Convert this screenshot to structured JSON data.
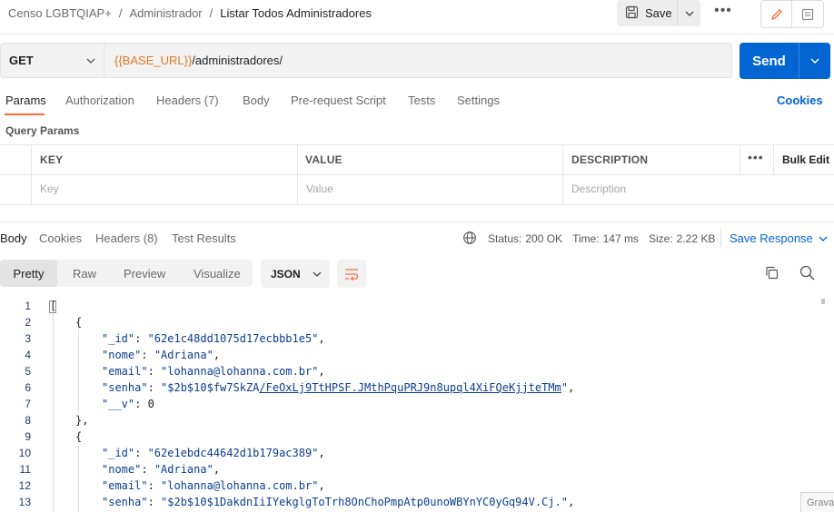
{
  "breadcrumb": {
    "collection": "Censo LGBTQIAP+",
    "folder": "Administrador",
    "separator": "/",
    "request": "Listar Todos Administradores"
  },
  "toolbar": {
    "save_label": "Save",
    "more_label": "•••"
  },
  "request": {
    "method": "GET",
    "url_variable": "{{BASE_URL}}",
    "url_path": "/administradores/",
    "send_label": "Send"
  },
  "request_tabs": [
    "Params",
    "Authorization",
    "Headers (7)",
    "Body",
    "Pre-request Script",
    "Tests",
    "Settings"
  ],
  "cookies_label": "Cookies",
  "query_params": {
    "title": "Query Params",
    "columns": [
      "KEY",
      "VALUE",
      "DESCRIPTION"
    ],
    "more_label": "•••",
    "bulk_edit_label": "Bulk Edit",
    "placeholders": [
      "Key",
      "Value",
      "Description"
    ]
  },
  "response_tabs": [
    "Body",
    "Cookies",
    "Headers (8)",
    "Test Results"
  ],
  "response_status": {
    "status_label": "Status:",
    "status_value": "200 OK",
    "time_label": "Time:",
    "time_value": "147 ms",
    "size_label": "Size:",
    "size_value": "2.22 KB",
    "save_response_label": "Save Response"
  },
  "view_modes": [
    "Pretty",
    "Raw",
    "Preview",
    "Visualize"
  ],
  "format": "JSON",
  "code_lines": [
    {
      "n": "1"
    },
    {
      "n": "2"
    },
    {
      "n": "3",
      "key": "\"_id\"",
      "value": "\"62e1c48dd1075d17ecbbb1e5\"",
      "tail": ","
    },
    {
      "n": "4",
      "key": "\"nome\"",
      "value": "\"Adriana\"",
      "tail": ","
    },
    {
      "n": "5",
      "key": "\"email\"",
      "value": "\"lohanna@lohanna.com.br\"",
      "tail": ","
    },
    {
      "n": "6",
      "key": "\"senha\"",
      "value_pre": "\"$2b$10$fw7SkZA",
      "value_link": "/FeOxLj9TtHPSF.JMthPquPRJ9n8upql4XiFQeKjjteTMm",
      "value_post": "\"",
      "tail": ","
    },
    {
      "n": "7",
      "key": "\"__v\"",
      "value": "0"
    },
    {
      "n": "8"
    },
    {
      "n": "9"
    },
    {
      "n": "10",
      "key": "\"_id\"",
      "value": "\"62e1ebdc44642d1b179ac389\"",
      "tail": ","
    },
    {
      "n": "11",
      "key": "\"nome\"",
      "value": "\"Adriana\"",
      "tail": ","
    },
    {
      "n": "12",
      "key": "\"email\"",
      "value": "\"lohanna@lohanna.com.br\"",
      "tail": ","
    },
    {
      "n": "13",
      "key": "\"senha\"",
      "value": "\"$2b$10$1DakdnIiIYekglgToTrh8OnChoPmpAtp0unoWBYnYC0yGq94V.Cj.\"",
      "tail": ","
    }
  ],
  "code_punctuation": {
    "open_array": "[",
    "open_object": "{",
    "close_object_comma": "},",
    "colon": ": "
  },
  "overlay_label": "Grava",
  "colors": {
    "accent": "#0265d2",
    "tab_indicator": "#ff6c37",
    "url_variable": "#e07b26",
    "json_string": "#0b3d91"
  }
}
